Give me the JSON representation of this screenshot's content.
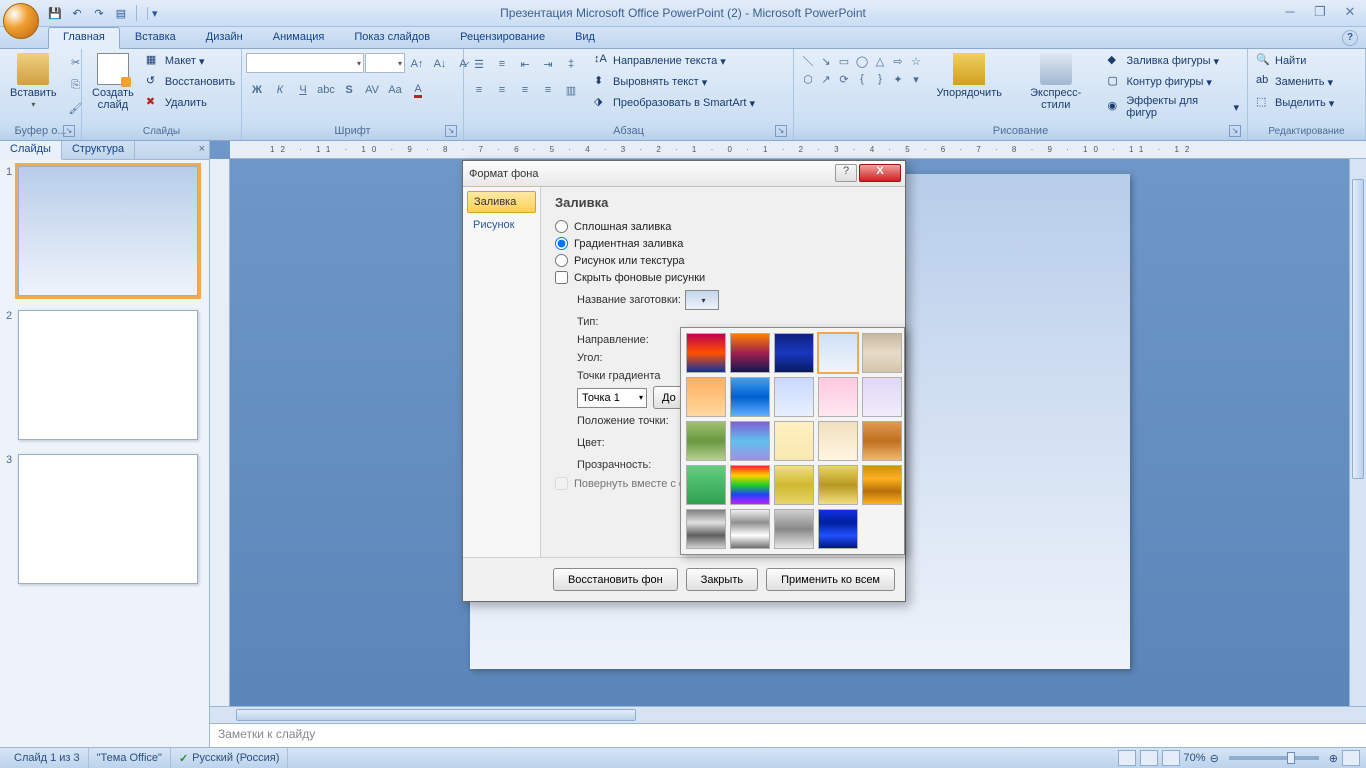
{
  "title": "Презентация Microsoft Office PowerPoint (2) - Microsoft PowerPoint",
  "tabs": [
    "Главная",
    "Вставка",
    "Дизайн",
    "Анимация",
    "Показ слайдов",
    "Рецензирование",
    "Вид"
  ],
  "active_tab": 0,
  "ribbon": {
    "clipboard": {
      "label": "Буфер о...",
      "paste": "Вставить"
    },
    "slides": {
      "label": "Слайды",
      "new": "Создать\nслайд",
      "layout": "Макет",
      "reset": "Восстановить",
      "delete": "Удалить"
    },
    "font": {
      "label": "Шрифт"
    },
    "paragraph": {
      "label": "Абзац",
      "direction": "Направление текста",
      "align": "Выровнять текст",
      "smartart": "Преобразовать в SmartArt"
    },
    "drawing": {
      "label": "Рисование",
      "arrange": "Упорядочить",
      "styles": "Экспресс-стили",
      "fill": "Заливка фигуры",
      "outline": "Контур фигуры",
      "effects": "Эффекты для фигур"
    },
    "editing": {
      "label": "Редактирование",
      "find": "Найти",
      "replace": "Заменить",
      "select": "Выделить"
    }
  },
  "pane_tabs": {
    "slides": "Слайды",
    "outline": "Структура"
  },
  "slide_numbers": [
    "1",
    "2",
    "3"
  ],
  "ruler_text": "12 · 11 · 10 · 9 · 8 · 7 · 6 · 5 · 4 · 3 · 2 · 1 · 0 · 1 · 2 · 3 · 4 · 5 · 6 · 7 · 8 · 9 · 10 · 11 · 12",
  "notes_placeholder": "Заметки к слайду",
  "status": {
    "slide": "Слайд 1 из 3",
    "theme": "\"Тема Office\"",
    "lang": "Русский (Россия)",
    "zoom": "70%"
  },
  "dialog": {
    "title": "Формат фона",
    "side": {
      "fill": "Заливка",
      "picture": "Рисунок"
    },
    "heading": "Заливка",
    "radios": {
      "solid": "Сплошная заливка",
      "gradient": "Градиентная заливка",
      "picture": "Рисунок или текстура"
    },
    "hide_bg": "Скрыть фоновые рисунки",
    "fields": {
      "preset": "Название заготовки:",
      "type": "Тип:",
      "direction": "Направление:",
      "angle": "Угол:",
      "stops": "Точки градиента",
      "stop_value": "Точка 1",
      "add": "До",
      "position": "Положение точки:",
      "color": "Цвет:",
      "transparency": "Прозрачность:"
    },
    "rotate": "Повернуть вместе с фигурой",
    "buttons": {
      "reset": "Восстановить фон",
      "close": "Закрыть",
      "apply_all": "Применить ко всем"
    }
  },
  "gradient_presets": [
    "linear-gradient(to bottom,#c00050,#ff5000,#1030a0)",
    "linear-gradient(to bottom,#ff8000,#a02050,#101850)",
    "linear-gradient(to bottom,#102080,#1838c0,#0a1860)",
    "linear-gradient(to bottom,#d0e0f5,#f0f5fc)",
    "linear-gradient(to bottom,#c8b8a0,#e8dcc8,#d4c4ac)",
    "linear-gradient(to bottom,#ffb060,#ffd8a0)",
    "linear-gradient(to bottom,#40a0f0,#0060d0,#60b0ff)",
    "linear-gradient(to bottom,#c8d8ff,#e8f0ff)",
    "linear-gradient(to bottom,#ffc8e0,#ffe8f0)",
    "linear-gradient(to bottom,#e0d8f8,#f0ecfc)",
    "linear-gradient(to bottom,#a0c070,#6a9840,#b8d090)",
    "linear-gradient(to bottom,#8060d0,#60c0f0,#a090e0)",
    "linear-gradient(to bottom,#fff0c0,#f8e8b0)",
    "linear-gradient(to bottom,#f0e0c0,#fff5e0)",
    "linear-gradient(to bottom,#e09850,#c07020,#f0b870)",
    "linear-gradient(to bottom,#60d080,#30a050)",
    "linear-gradient(to bottom,#ff2020,#ffd000,#20d020,#2040ff,#c020ff)",
    "linear-gradient(to bottom,#f0e080,#d0b830,#e8d468)",
    "linear-gradient(to bottom,#e8d860,#b89820,#f0e080)",
    "linear-gradient(to bottom,#d09010,#ffb020,#b87008,#ffb020)",
    "linear-gradient(to bottom,#808080,#e0e0e0,#606060,#d0d0d0)",
    "linear-gradient(to bottom,#f0f0f0,#909090,#ffffff,#707070)",
    "linear-gradient(to bottom,#d0d0d0,#888888,#e8e8e8)",
    "linear-gradient(to bottom,#1030e0,#0020a0,#2050ff,#001880)"
  ]
}
